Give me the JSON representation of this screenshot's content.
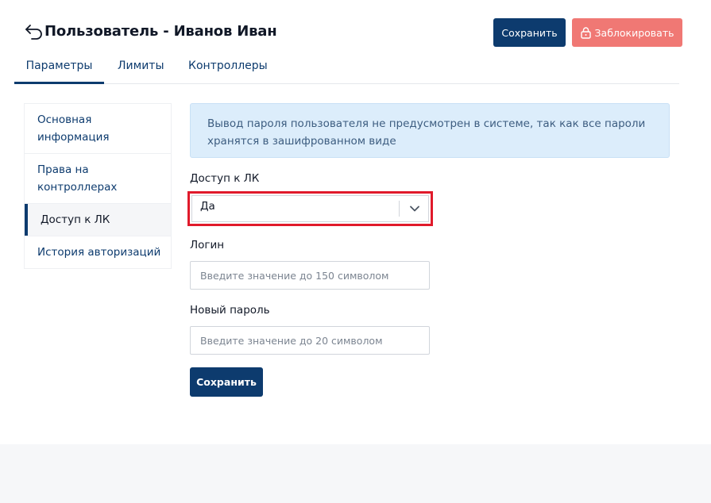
{
  "header": {
    "title": "Пользователь - Иванов Иван",
    "save_label": "Сохранить",
    "block_label": "Заблокировать"
  },
  "tabs": [
    {
      "label": "Параметры",
      "active": true
    },
    {
      "label": "Лимиты",
      "active": false
    },
    {
      "label": "Контроллеры",
      "active": false
    }
  ],
  "side_menu": [
    {
      "label": "Основная информация",
      "active": false
    },
    {
      "label": "Права на контроллерах",
      "active": false
    },
    {
      "label": "Доступ к ЛК",
      "active": true
    },
    {
      "label": "История авторизаций",
      "active": false
    }
  ],
  "info_text": "Вывод пароля пользователя не предусмотрен в системе, так как все пароли хранятся в зашифрованном виде",
  "form": {
    "access_label": "Доступ к ЛК",
    "access_value": "Да",
    "login_label": "Логин",
    "login_value": "",
    "login_placeholder": "Введите значение до 150 символом",
    "password_label": "Новый пароль",
    "password_value": "",
    "password_placeholder": "Введите значение до 20 символом",
    "save_label": "Сохранить"
  },
  "icons": {
    "back": "back-arrow-icon",
    "lock": "lock-icon",
    "chevron": "chevron-down-icon"
  },
  "colors": {
    "primary": "#0d3b6e",
    "danger": "#f07874",
    "info_bg": "#dcedfb",
    "highlight": "#e01a2b"
  }
}
